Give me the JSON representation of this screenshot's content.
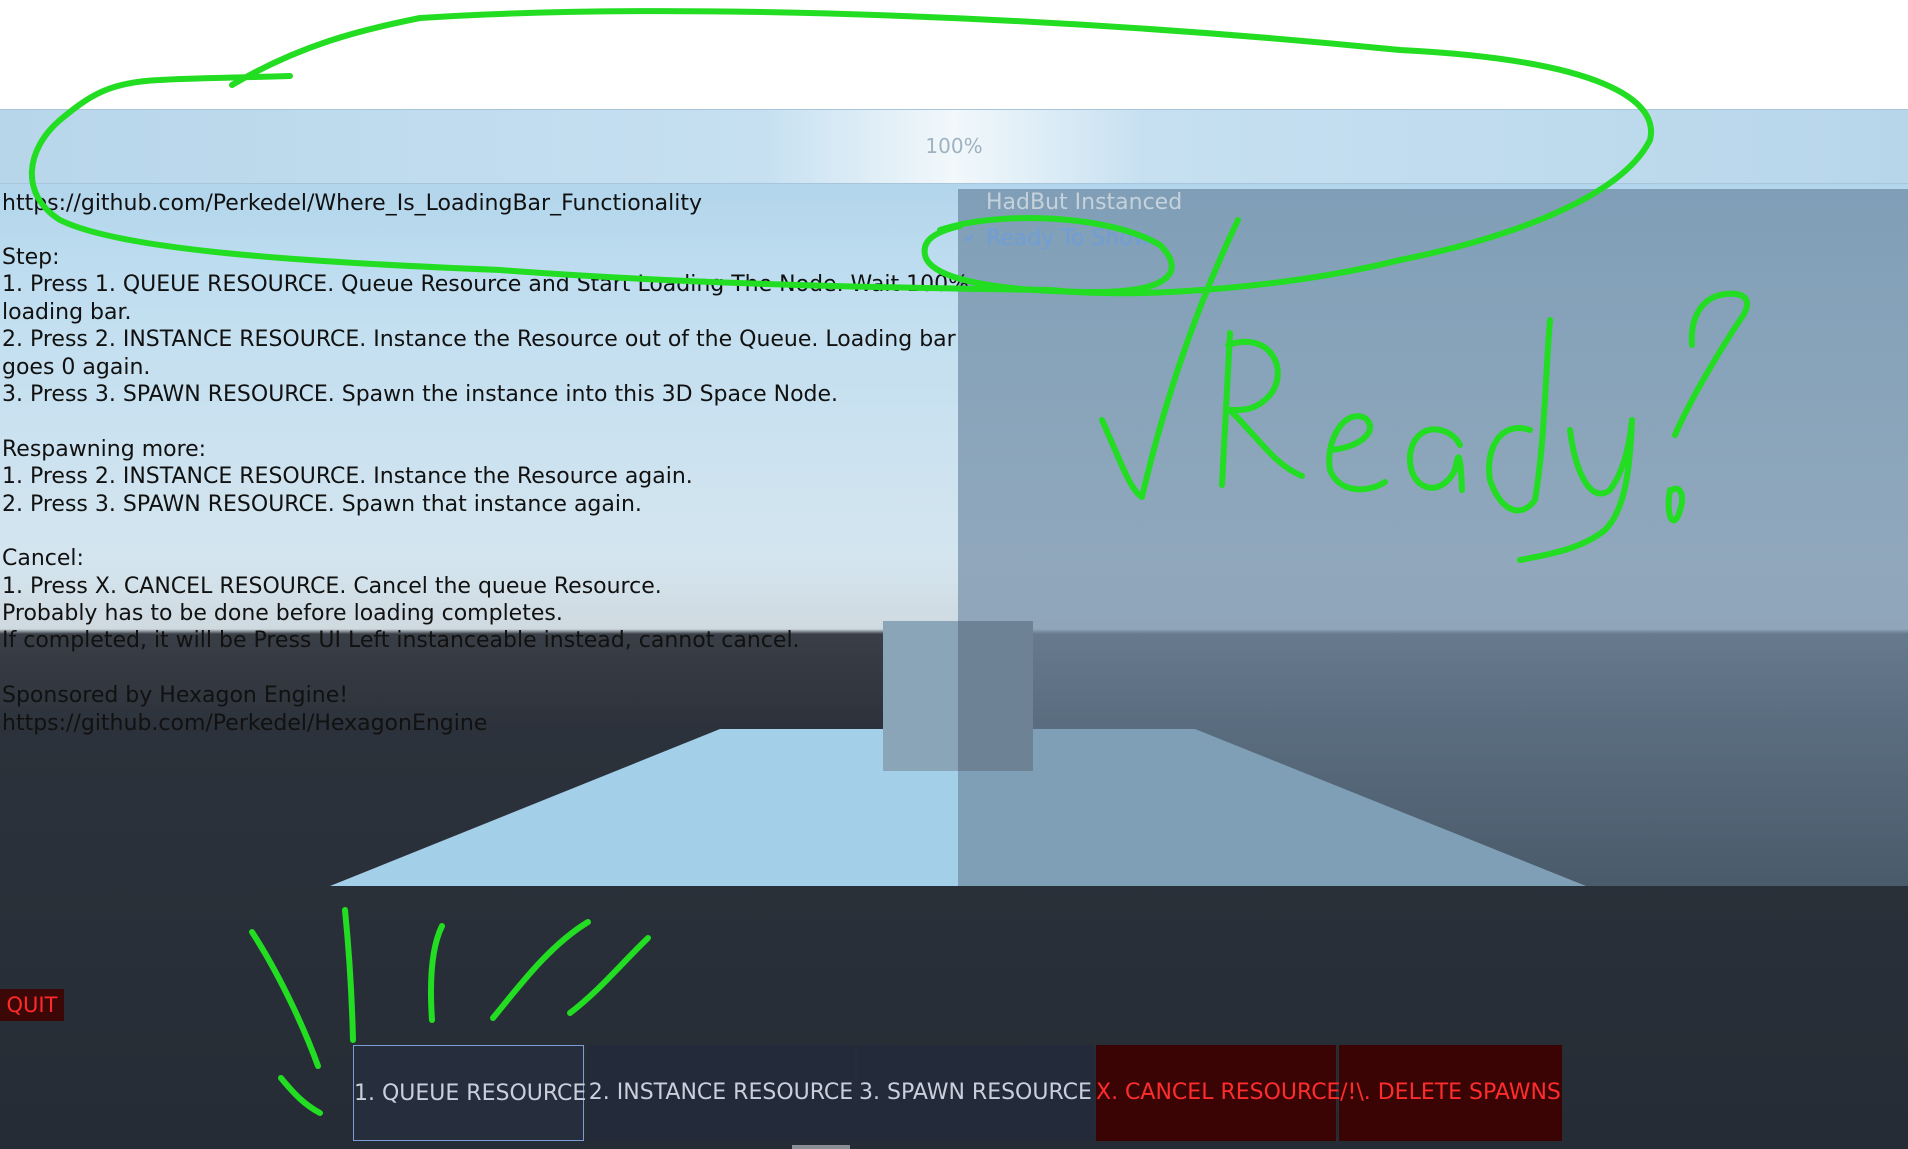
{
  "loading_bar": {
    "label": "100%",
    "progress": 1.0
  },
  "info": {
    "url": "https://github.com/Perkedel/Where_Is_LoadingBar_Functionality",
    "lines": [
      "Step:",
      "1. Press 1. QUEUE RESOURCE. Queue Resource and Start Loading The Node. Wait 100%",
      "loading bar.",
      "2. Press 2. INSTANCE RESOURCE. Instance the Resource out of the Queue. Loading bar",
      "goes 0 again.",
      "3. Press 3. SPAWN RESOURCE. Spawn the instance into this 3D Space Node.",
      "",
      "Respawning more:",
      "1. Press 2. INSTANCE RESOURCE. Instance the Resource again.",
      "2. Press 3. SPAWN RESOURCE. Spawn that instance again.",
      "",
      "Cancel:",
      "1. Press X. CANCEL RESOURCE. Cancel the queue Resource.",
      "Probably has to be done before loading completes.",
      "If completed, it will be Press UI Left instanceable instead, cannot cancel.",
      "",
      "Sponsored by Hexagon Engine!",
      "https://github.com/Perkedel/HexagonEngine"
    ]
  },
  "status": {
    "instanced_label": "HadBut Instanced",
    "instanced_checked": false,
    "ready_label": "Ready To Show",
    "ready_checked": true
  },
  "quit_label": "QUIT",
  "toolbar": {
    "queue_label": "1. QUEUE RESOURCE",
    "instance_label": "2. INSTANCE RESOURCE",
    "spawn_label": "3. SPAWN RESOURCE",
    "cancel_label": "X. CANCEL RESOURCE",
    "delete_label": "/!\\. DELETE SPAWNS"
  },
  "annotation": {
    "text": "Ready!",
    "color": "#22dd22"
  },
  "colors": {
    "danger_text": "#ff2c2c",
    "danger_bg": "#3a0404",
    "ready_text": "#6f9ed6",
    "annotation": "#22dd22"
  }
}
